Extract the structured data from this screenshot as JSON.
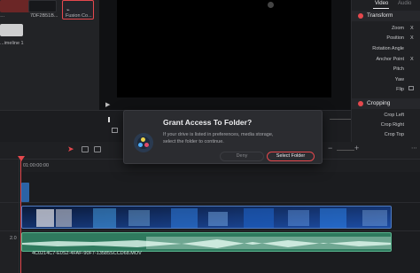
{
  "media_pool": {
    "clips": [
      {
        "caption": "…",
        "color": "#7a2a2a"
      },
      {
        "caption": "7DF2B51B...",
        "color": "#191a1d"
      },
      {
        "caption": "Fusion Co...",
        "color": "#24252a"
      },
      {
        "caption": "...imeline 1",
        "color": "#c9c9c9"
      }
    ]
  },
  "inspector": {
    "tabs": [
      "Video",
      "Audio"
    ],
    "transform": {
      "title": "Transform",
      "props": [
        {
          "label": "Zoom",
          "value": "X"
        },
        {
          "label": "Position",
          "value": "X"
        },
        {
          "label": "Rotation Angle",
          "value": ""
        },
        {
          "label": "Anchor Point",
          "value": "X"
        },
        {
          "label": "Pitch",
          "value": ""
        },
        {
          "label": "Yaw",
          "value": ""
        },
        {
          "label": "Flip",
          "value": ""
        }
      ]
    },
    "cropping": {
      "title": "Cropping",
      "props": [
        {
          "label": "Crop Left"
        },
        {
          "label": "Crop Right"
        },
        {
          "label": "Crop Top"
        }
      ]
    }
  },
  "timeline": {
    "timecode": "01:00:00:00",
    "audio_track_level": "2.0",
    "audio_clip_name": "4C0214C7-E0S2-4FAF-90F7-13585SCCD68.MOV"
  },
  "dialog": {
    "title": "Grant Access To Folder?",
    "body": "If your drive is listed in preferences, media storage, select the folder to continue.",
    "deny_label": "Deny",
    "select_label": "Select Folder"
  },
  "colors": {
    "accent": "#e5484d",
    "video_clip": "#2d4f86",
    "audio_clip": "#2f7a5e"
  }
}
